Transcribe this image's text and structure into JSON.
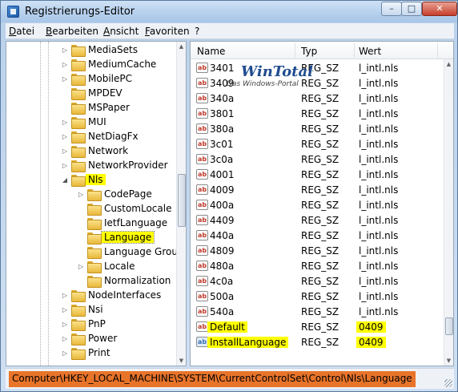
{
  "window": {
    "title": "Registrierungs-Editor",
    "controls": {
      "minimize": "–",
      "maximize": "□",
      "close": "✕"
    }
  },
  "menu": [
    "Datei",
    "Bearbeiten",
    "Ansicht",
    "Favoriten",
    "?"
  ],
  "tree": [
    {
      "label": "MediaSets",
      "expander": "▷",
      "level": 0
    },
    {
      "label": "MediumCache",
      "expander": "▷",
      "level": 0
    },
    {
      "label": "MobilePC",
      "expander": "▷",
      "level": 0
    },
    {
      "label": "MPDEV",
      "expander": "",
      "level": 0
    },
    {
      "label": "MSPaper",
      "expander": "",
      "level": 0
    },
    {
      "label": "MUI",
      "expander": "▷",
      "level": 0
    },
    {
      "label": "NetDiagFx",
      "expander": "▷",
      "level": 0
    },
    {
      "label": "Network",
      "expander": "▷",
      "level": 0
    },
    {
      "label": "NetworkProvider",
      "expander": "▷",
      "level": 0
    },
    {
      "label": "Nls",
      "expander": "◢",
      "level": 0,
      "highlight": true
    },
    {
      "label": "CodePage",
      "expander": "▷",
      "level": 1
    },
    {
      "label": "CustomLocale",
      "expander": "",
      "level": 1
    },
    {
      "label": "IetfLanguage",
      "expander": "",
      "level": 1
    },
    {
      "label": "Language",
      "expander": "",
      "level": 1,
      "selected": true
    },
    {
      "label": "Language Group",
      "expander": "",
      "level": 1
    },
    {
      "label": "Locale",
      "expander": "▷",
      "level": 1
    },
    {
      "label": "Normalization",
      "expander": "",
      "level": 1
    },
    {
      "label": "NodeInterfaces",
      "expander": "▷",
      "level": 0
    },
    {
      "label": "Nsi",
      "expander": "▷",
      "level": 0
    },
    {
      "label": "PnP",
      "expander": "▷",
      "level": 0
    },
    {
      "label": "Power",
      "expander": "▷",
      "level": 0
    },
    {
      "label": "Print",
      "expander": "▷",
      "level": 0
    }
  ],
  "list": {
    "headers": {
      "name": "Name",
      "type": "Typ",
      "data": "Wert"
    },
    "rows": [
      {
        "name": "3401",
        "type": "REG_SZ",
        "data": "l_intl.nls",
        "icon": "ab"
      },
      {
        "name": "3409",
        "type": "REG_SZ",
        "data": "l_intl.nls",
        "icon": "ab"
      },
      {
        "name": "340a",
        "type": "REG_SZ",
        "data": "l_intl.nls",
        "icon": "ab"
      },
      {
        "name": "3801",
        "type": "REG_SZ",
        "data": "l_intl.nls",
        "icon": "ab"
      },
      {
        "name": "380a",
        "type": "REG_SZ",
        "data": "l_intl.nls",
        "icon": "ab"
      },
      {
        "name": "3c01",
        "type": "REG_SZ",
        "data": "l_intl.nls",
        "icon": "ab"
      },
      {
        "name": "3c0a",
        "type": "REG_SZ",
        "data": "l_intl.nls",
        "icon": "ab"
      },
      {
        "name": "4001",
        "type": "REG_SZ",
        "data": "l_intl.nls",
        "icon": "ab"
      },
      {
        "name": "4009",
        "type": "REG_SZ",
        "data": "l_intl.nls",
        "icon": "ab"
      },
      {
        "name": "400a",
        "type": "REG_SZ",
        "data": "l_intl.nls",
        "icon": "ab"
      },
      {
        "name": "4409",
        "type": "REG_SZ",
        "data": "l_intl.nls",
        "icon": "ab"
      },
      {
        "name": "440a",
        "type": "REG_SZ",
        "data": "l_intl.nls",
        "icon": "ab"
      },
      {
        "name": "4809",
        "type": "REG_SZ",
        "data": "l_intl.nls",
        "icon": "ab"
      },
      {
        "name": "480a",
        "type": "REG_SZ",
        "data": "l_intl.nls",
        "icon": "ab"
      },
      {
        "name": "4c0a",
        "type": "REG_SZ",
        "data": "l_intl.nls",
        "icon": "ab"
      },
      {
        "name": "500a",
        "type": "REG_SZ",
        "data": "l_intl.nls",
        "icon": "ab"
      },
      {
        "name": "540a",
        "type": "REG_SZ",
        "data": "l_intl.nls",
        "icon": "ab"
      },
      {
        "name": "Default",
        "type": "REG_SZ",
        "data": "0409",
        "icon": "ab",
        "highlight": true
      },
      {
        "name": "InstallLanguage",
        "type": "REG_SZ",
        "data": "0409",
        "icon": "ab",
        "highlight": true
      }
    ]
  },
  "watermark": {
    "title": "WinTotal",
    "subtitle": "Das Windows-Portal"
  },
  "status": {
    "path": "Computer\\HKEY_LOCAL_MACHINE\\SYSTEM\\CurrentControlSet\\Control\\Nls\\Language"
  },
  "colors": {
    "highlight": "#ffff00",
    "status_highlight": "#e8742a"
  }
}
